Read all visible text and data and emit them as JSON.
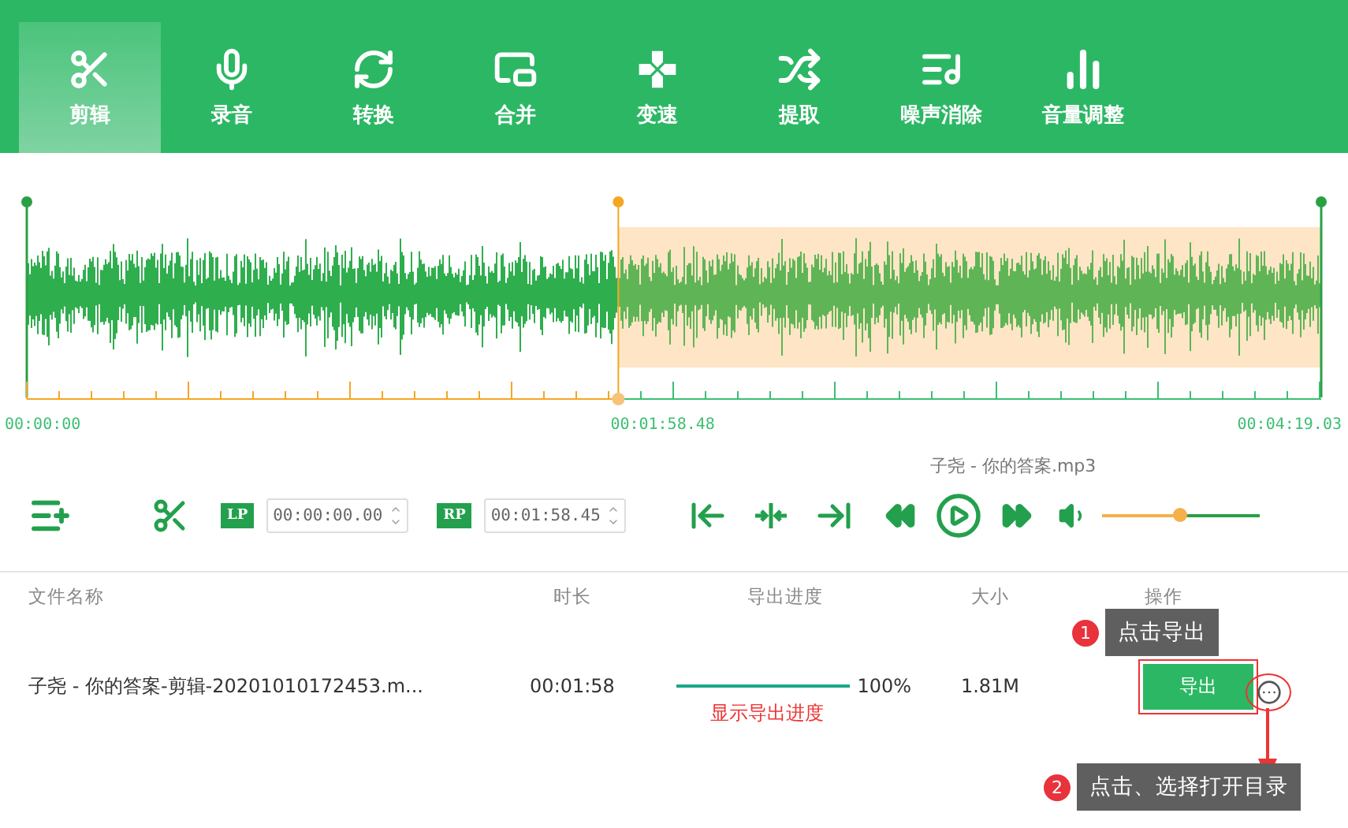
{
  "tabs": [
    {
      "label": "剪辑",
      "selected": true
    },
    {
      "label": "录音",
      "selected": false
    },
    {
      "label": "转换",
      "selected": false
    },
    {
      "label": "合并",
      "selected": false
    },
    {
      "label": "变速",
      "selected": false
    },
    {
      "label": "提取",
      "selected": false
    },
    {
      "label": "噪声消除",
      "selected": false
    },
    {
      "label": "音量调整",
      "selected": false
    }
  ],
  "timeline": {
    "start": "00:00:00",
    "marker": "00:01:58.48",
    "end": "00:04:19.03",
    "playhead": {
      "level": 0.457
    }
  },
  "player": {
    "track_title": "子尧 - 你的答案.mp3",
    "lp_label": "LP",
    "lp_value": "00:00:00.00",
    "rp_label": "RP",
    "rp_value": "00:01:58.45",
    "volume": {
      "level": 0.49
    }
  },
  "table": {
    "columns": [
      "文件名称",
      "时长",
      "导出进度",
      "大小",
      "操作"
    ],
    "rows": [
      {
        "name": "子尧 - 你的答案-剪辑-20201010172453.m...",
        "duration": "00:01:58",
        "progress": {
          "level": 1
        },
        "percent": "100%",
        "size": "1.81M",
        "action": "导出"
      }
    ]
  },
  "progress_note": "显示导出进度",
  "annotations": [
    {
      "number": "1",
      "text": "点击导出"
    },
    {
      "number": "2",
      "text": "点击、选择打开目录"
    }
  ]
}
